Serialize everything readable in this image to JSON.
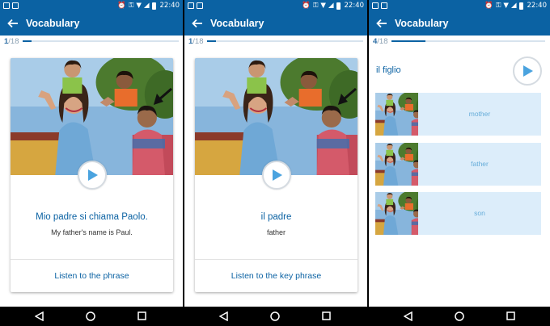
{
  "status": {
    "time": "22:40"
  },
  "colors": {
    "primary": "#0b62a3",
    "option_bg": "#dcedfa",
    "option_text": "#65acd9"
  },
  "panels": [
    {
      "title": "Vocabulary",
      "progress": {
        "current": "1",
        "total": "/18",
        "fraction": 0.056
      },
      "card": {
        "phrase": "Mio padre si chiama Paolo.",
        "translation": "My father's name is Paul.",
        "action": "Listen to the phrase"
      }
    },
    {
      "title": "Vocabulary",
      "progress": {
        "current": "1",
        "total": "/18",
        "fraction": 0.056
      },
      "card": {
        "phrase": "il padre",
        "translation": "father",
        "action": "Listen to the key phrase"
      }
    },
    {
      "title": "Vocabulary",
      "progress": {
        "current": "4",
        "total": "/18",
        "fraction": 0.222
      },
      "question": {
        "word": "il figlio"
      },
      "options": [
        {
          "label": "mother"
        },
        {
          "label": "father"
        },
        {
          "label": "son"
        }
      ]
    }
  ],
  "icons": [
    "back-arrow-icon",
    "play-icon",
    "nav-back-icon",
    "nav-home-icon",
    "nav-recent-icon",
    "wifi-icon",
    "signal-icon",
    "battery-icon",
    "alarm-icon",
    "key-icon",
    "image-icon"
  ]
}
